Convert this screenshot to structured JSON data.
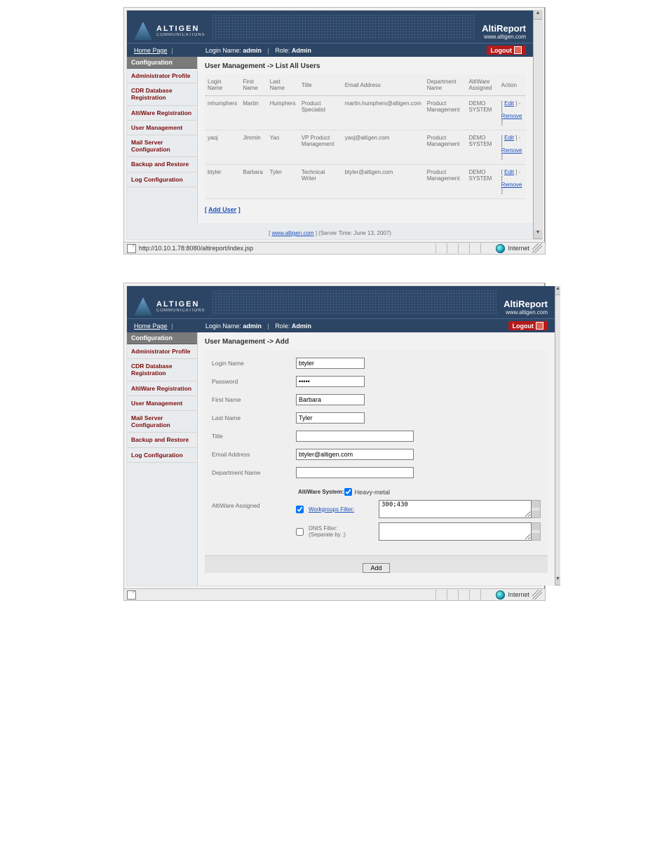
{
  "brand": {
    "company_big": "ALTIGEN",
    "company_small": "COMMUNICATIONS",
    "product": "AltiReport",
    "url": "www.altigen.com"
  },
  "topnav": {
    "home": "Home Page",
    "login_label": "Login Name:",
    "login_value": "admin",
    "role_label": "Role:",
    "role_value": "Admin",
    "logout": "Logout"
  },
  "sidebar": {
    "tab": "Configuration",
    "items": [
      "Administrator Profile",
      "CDR Database Registration",
      "AltiWare Registration",
      "User Management",
      "Mail Server Configuration",
      "Backup and Restore",
      "Log Configuration"
    ]
  },
  "list_screen": {
    "title": "User Management  ->  List All Users",
    "headers": [
      "Login Name",
      "First Name",
      "Last Name",
      "Title",
      "Email Address",
      "Department Name",
      "AltiWare Assigned",
      "Action"
    ],
    "rows": [
      {
        "login": "mhumphers",
        "first": "Martin",
        "last": "Humphers",
        "title": "Product Specialist",
        "email": "martin.humphers@altigen.com",
        "dept": "Product Management",
        "aw": "DEMO SYSTEM",
        "edit": "Edit",
        "remove": "Remove"
      },
      {
        "login": "yaoj",
        "first": "Jimmin",
        "last": "Yao",
        "title": "VP Product Management",
        "email": "yaoj@altigen.com",
        "dept": "Product Management",
        "aw": "DEMO SYSTEM",
        "edit": "Edit",
        "remove": "Remove"
      },
      {
        "login": "btyler",
        "first": "Barbara",
        "last": "Tyler",
        "title": "Technical Writer",
        "email": "btyler@altigen.com",
        "dept": "Product Management",
        "aw": "DEMO SYSTEM",
        "edit": "Edit",
        "remove": "Remove"
      }
    ],
    "add_user": "Add User",
    "footer_link": "www.altigen.com",
    "footer_time": "(Server Time: June 13, 2007)"
  },
  "status": {
    "url": "http://10.10.1.78:8080/altireport/index.jsp",
    "zone": "Internet"
  },
  "form_screen": {
    "title": "User Management  ->  Add",
    "fields": {
      "login_lbl": "Login Name",
      "login_val": "btyler",
      "pass_lbl": "Password",
      "pass_val": "•••••",
      "first_lbl": "First Name",
      "first_val": "Barbara",
      "last_lbl": "Last Name",
      "last_val": "Tyler",
      "title_lbl": "Title",
      "title_val": "",
      "email_lbl": "Email Address",
      "email_val": "btyler@altigen.com",
      "dept_lbl": "Department Name",
      "dept_val": "",
      "aw_lbl": "AltiWare Assigned",
      "aw_sys_lbl": "AltiWare System:",
      "aw_sys_val": "Heavy-metal",
      "wg_lbl": "Workgroups Filter:",
      "wg_val": "300;430",
      "dnis_lbl": "DNIS Filter:",
      "dnis_sub": "(Separate by ;)",
      "add_btn": "Add"
    }
  }
}
